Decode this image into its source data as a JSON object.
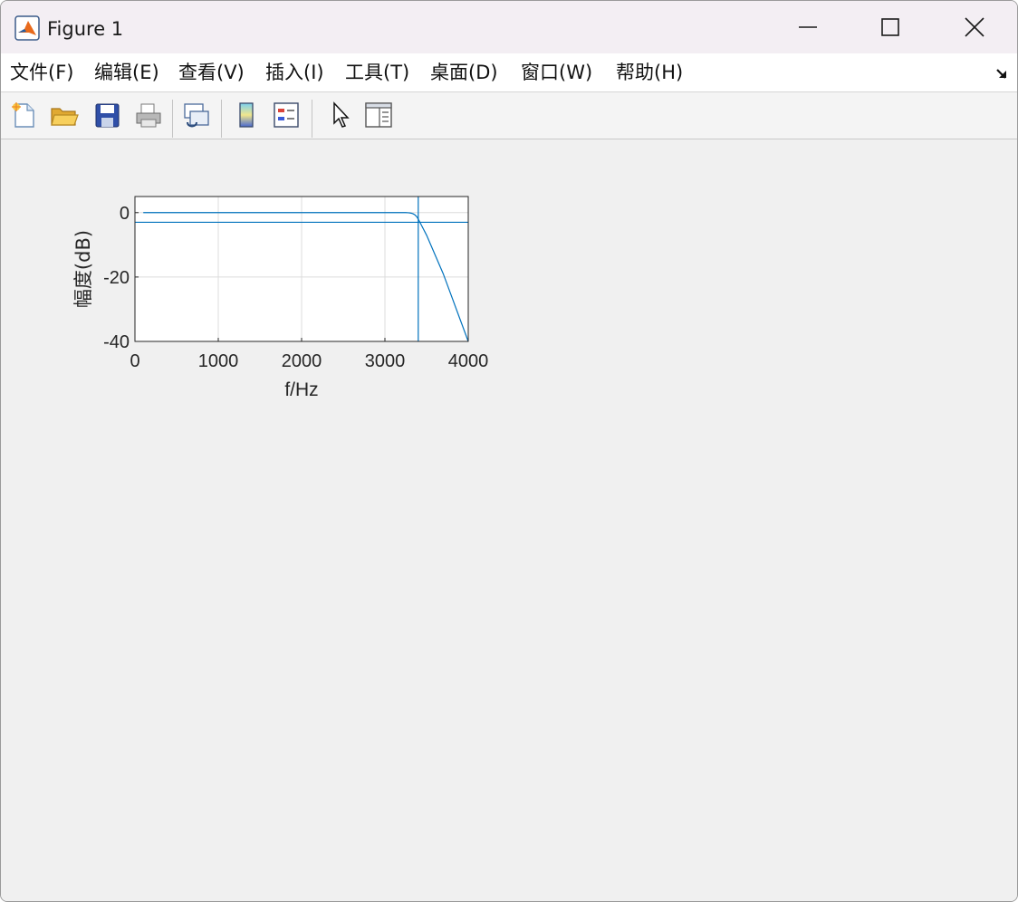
{
  "window": {
    "title": "Figure 1"
  },
  "menu": [
    {
      "label": "文件(F)"
    },
    {
      "label": "编辑(E)"
    },
    {
      "label": "查看(V)"
    },
    {
      "label": "插入(I)"
    },
    {
      "label": "工具(T)"
    },
    {
      "label": "桌面(D)"
    },
    {
      "label": "窗口(W)"
    },
    {
      "label": "帮助(H)"
    }
  ],
  "toolbar": [
    {
      "icon": "new-figure-icon"
    },
    {
      "icon": "open-file-icon"
    },
    {
      "icon": "save-icon"
    },
    {
      "icon": "print-icon"
    },
    {
      "icon": "link-plot-icon"
    },
    {
      "icon": "insert-colorbar-icon"
    },
    {
      "icon": "insert-legend-icon"
    },
    {
      "icon": "edit-plot-pointer-icon"
    },
    {
      "icon": "property-inspector-icon"
    }
  ],
  "colors": {
    "line": "#0072bd",
    "axes_bg": "#ffffff",
    "grid": "#dcdcdc",
    "figure_bg": "#f0f0f0"
  },
  "chart_data": {
    "type": "line",
    "xlabel": "f/Hz",
    "ylabel": "幅度(dB)",
    "xlim": [
      0,
      4000
    ],
    "ylim": [
      -40,
      5
    ],
    "xticks": [
      0,
      1000,
      2000,
      3000,
      4000
    ],
    "yticks": [
      0,
      -20,
      -40
    ],
    "grid": true,
    "series": [
      {
        "x": [
          100,
          3000,
          3100,
          3150,
          3200,
          3250,
          3280,
          3300,
          3320,
          3340,
          3360,
          3380,
          3400,
          3440,
          3500,
          3600,
          3700,
          3800,
          3900,
          4000
        ],
        "y": [
          0,
          0,
          0,
          0,
          0,
          0,
          -0.05,
          -0.1,
          -0.2,
          -0.4,
          -0.7,
          -1.2,
          -2,
          -4,
          -7,
          -13,
          -19,
          -26,
          -33,
          -40
        ]
      }
    ],
    "reference_lines": [
      {
        "orientation": "horizontal",
        "y": -3
      },
      {
        "orientation": "vertical",
        "x": 3400
      }
    ]
  }
}
